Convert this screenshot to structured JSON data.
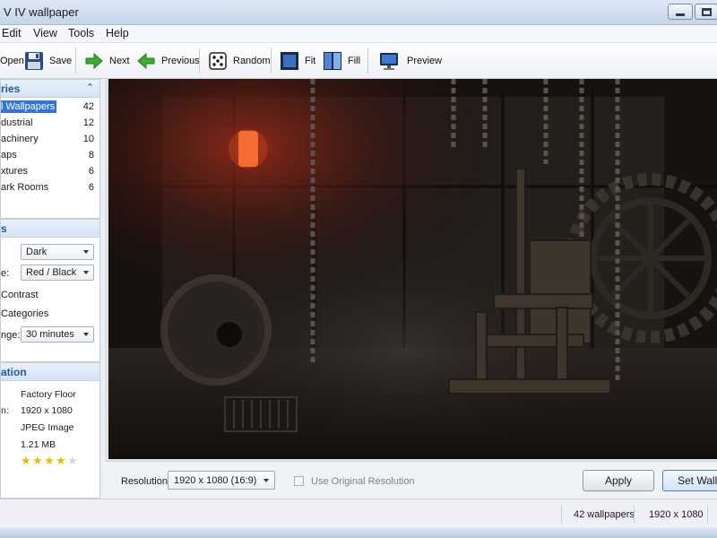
{
  "window": {
    "title": "V IV wallpaper"
  },
  "menu": [
    "Edit",
    "View",
    "Tools",
    "Help"
  ],
  "toolbar": {
    "open": "Open",
    "save": "Save",
    "next": "Next",
    "previous": "Previous",
    "random": "Random",
    "fit": "Fit",
    "fill": "Fill",
    "preview": "Preview"
  },
  "categories": {
    "header": "ries",
    "items": [
      {
        "name": "l Wallpapers",
        "count": "42",
        "selected": true
      },
      {
        "name": "dustrial",
        "count": "12"
      },
      {
        "name": "achinery",
        "count": "10"
      },
      {
        "name": "aps",
        "count": "8"
      },
      {
        "name": "xtures",
        "count": "6"
      },
      {
        "name": "ark Rooms",
        "count": "6"
      }
    ]
  },
  "options": {
    "header": "s",
    "theme_value": "Dark",
    "color_label": "e:",
    "color_value": "Red / Black",
    "contrast_label": "Contrast",
    "categories_label": "Categories",
    "interval_label": "nge:",
    "interval_value": "30 minutes"
  },
  "information": {
    "header": "ation",
    "name_value": "Factory Floor",
    "res_label": "n:",
    "res_value": "1920 x 1080",
    "type_value": "JPEG Image",
    "size_value": "1.21 MB",
    "rating": 4,
    "rating_max": 5
  },
  "bottom": {
    "resolution_label": "Resolution:",
    "resolution_value": "1920 x 1080 (16:9)",
    "original_label": "Use Original Resolution",
    "apply": "Apply",
    "set_wallpaper": "Set Wallpaper"
  },
  "status": {
    "count": "42 wallpapers",
    "resolution": "1920 x 1080"
  },
  "colors": {
    "accent": "#3375d6",
    "header_text": "#1f5aa6",
    "star": "#f2b807"
  }
}
